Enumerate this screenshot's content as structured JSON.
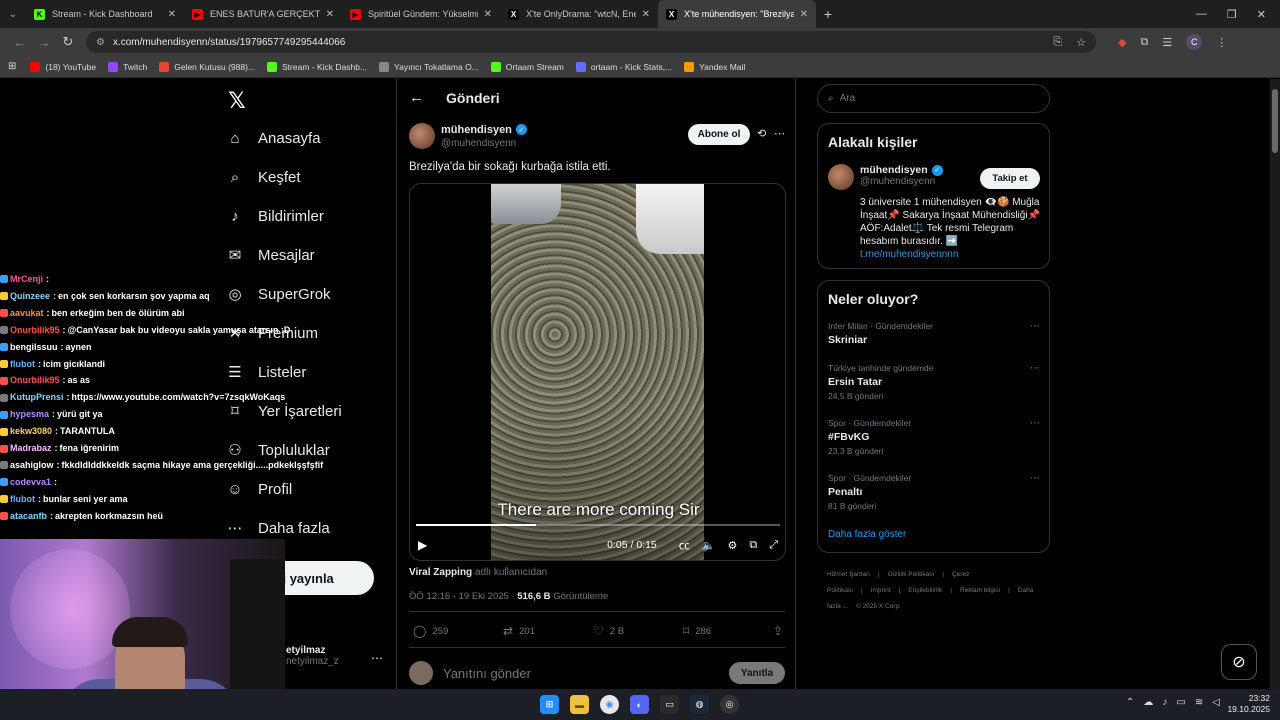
{
  "browser": {
    "tabs": [
      {
        "title": "Stream - Kick Dashboard",
        "icon": "kick-icon",
        "active": false
      },
      {
        "title": "ENES BATUR'A GERÇEKTEN NE",
        "icon": "youtube-icon",
        "active": false
      },
      {
        "title": "Spiritüel Gündem: Yükselmiş Ü",
        "icon": "youtube-icon",
        "active": false
      },
      {
        "title": "X'te OnlyDrama: \"wtcN, Enes B",
        "icon": "x-icon",
        "active": false
      },
      {
        "title": "X'te mühendisyen: \"Brezilya'da",
        "icon": "x-icon",
        "active": true
      }
    ],
    "url": "x.com/muhendisyenn/status/1979657749295444066",
    "avatar_letter": "C",
    "bookmarks": [
      {
        "label": "(18) YouTube",
        "icon": "youtube-icon",
        "color": "#ff0000"
      },
      {
        "label": "Twitch",
        "icon": "twitch-icon",
        "color": "#9146ff"
      },
      {
        "label": "Gelen Kutusu (988)...",
        "icon": "gmail-icon",
        "color": "#ea4335"
      },
      {
        "label": "Stream - Kick Dashb...",
        "icon": "kick-icon",
        "color": "#53fc18"
      },
      {
        "label": "Yayıncı Tokatlama O...",
        "icon": "globe-icon",
        "color": "#888888"
      },
      {
        "label": "Ortaam Stream",
        "icon": "kick-icon",
        "color": "#53fc18"
      },
      {
        "label": "ortaam - Kick Stats,...",
        "icon": "chart-icon",
        "color": "#6a6aff"
      },
      {
        "label": "Yandex Mail",
        "icon": "mail-icon",
        "color": "#ff9900"
      }
    ]
  },
  "nav": {
    "items": [
      {
        "label": "Anasayfa",
        "icon": "home-icon",
        "glyph": "⌂"
      },
      {
        "label": "Keşfet",
        "icon": "search-icon",
        "glyph": "⌕"
      },
      {
        "label": "Bildirimler",
        "icon": "bell-icon",
        "glyph": "♪"
      },
      {
        "label": "Mesajlar",
        "icon": "mail-icon",
        "glyph": "✉"
      },
      {
        "label": "SuperGrok",
        "icon": "grok-icon",
        "glyph": "◎"
      },
      {
        "label": "Premium",
        "icon": "x-icon",
        "glyph": "✕"
      },
      {
        "label": "Listeler",
        "icon": "list-icon",
        "glyph": "☰"
      },
      {
        "label": "Yer İşaretleri",
        "icon": "bookmark-icon",
        "glyph": "⌑"
      },
      {
        "label": "Topluluklar",
        "icon": "people-icon",
        "glyph": "⚇"
      },
      {
        "label": "Profil",
        "icon": "person-icon",
        "glyph": "☺"
      },
      {
        "label": "Daha fazla",
        "icon": "more-circle-icon",
        "glyph": "⋯"
      }
    ],
    "post_button": "eri yayınla",
    "account_name": "etyilmaz",
    "account_handle": "netyilmaz_z"
  },
  "chat": [
    {
      "user": "MrCenji",
      "msg": "",
      "color": "#ff4fa0"
    },
    {
      "user": "Quinzeee",
      "msg": "en çok sen korkarsın şov yapma aq",
      "color": "#7fd6ff"
    },
    {
      "user": "aavukat",
      "msg": "ben erkeğim ben de ölürüm abi",
      "color": "#ff8c42"
    },
    {
      "user": "Onurbilik95",
      "msg": "@CanYasar bak bu videoyu sakla yamuşa atarsın :D",
      "color": "#ff4f4f"
    },
    {
      "user": "bengilssuu",
      "msg": "aynen",
      "color": "#ffffff"
    },
    {
      "user": "flubot",
      "msg": "icim gicıklandi",
      "color": "#6ab0ff"
    },
    {
      "user": "Onurbilik95",
      "msg": "as as",
      "color": "#ff4f4f"
    },
    {
      "user": "KutupPrensi",
      "msg": "https://www.youtube.com/watch?v=7zsqkWoKaqs",
      "color": "#7fd6ff"
    },
    {
      "user": "hypesma",
      "msg": "yürü git ya",
      "color": "#b48cff"
    },
    {
      "user": "kekw3080",
      "msg": "TARANTULA",
      "color": "#ffd24f"
    },
    {
      "user": "Madrabaz",
      "msg": "fena iğrenirim",
      "color": "#ffb6ff"
    },
    {
      "user": "asahiglow",
      "msg": "fkkdldlddkkeldk saçma hikaye ama gerçekliği.....pdkeklşşfşfif",
      "color": "#ffffff"
    },
    {
      "user": "codevva1",
      "msg": "",
      "color": "#b48cff"
    },
    {
      "user": "flubot",
      "msg": "bunlar seni yer ama",
      "color": "#6ab0ff"
    },
    {
      "user": "atacanfb",
      "msg": "akrepten korkmazsın heü",
      "color": "#7fd6ff"
    }
  ],
  "main": {
    "header_title": "Gönderi",
    "author_name": "mühendisyen",
    "author_handle": "@muhendisyenn",
    "follow_label": "Abone ol",
    "tweet_text": "Brezilya'da bir sokağı kurbağa istila etti.",
    "video": {
      "subtitle": "There are more coming Sir",
      "time": "0:05 / 0:15",
      "progress": 0.33
    },
    "credit_name": "Viral Zapping",
    "credit_suffix": "adlı kullanıcıdan",
    "timestamp": "ÖÖ 12:16 · 19 Eki 2025 · ",
    "views_count": "516,6 B",
    "views_label": "Görüntüleme",
    "stats": {
      "replies": "259",
      "reposts": "201",
      "likes": "2 B",
      "bookmarks": "286"
    },
    "reply_placeholder": "Yanıtını gönder",
    "reply_button": "Yanıtla"
  },
  "sidebar": {
    "search_placeholder": "Ara",
    "related_title": "Alakalı kişiler",
    "related_name": "mühendisyen",
    "related_handle": "@muhendisyenn",
    "related_follow": "Takip et",
    "bio": "3 üniversite 1 mühendisyen 👁‍🗨🍪 Muğla İnşaat📌 Sakarya İnşaat Mühendisliği📌 AÖF:Adalet⚖️ Tek resmi Telegram hesabım burasıdır. ➡️",
    "bio_link": "t.me/muhendisyennnn",
    "trends_title": "Neler oluyor?",
    "trends": [
      {
        "context": "Inter Milan · Gündemdekiler",
        "name": "Skriniar",
        "posts": ""
      },
      {
        "context": "Türkiye tarihinde gündemde",
        "name": "Ersin Tatar",
        "posts": "24,5 B gönderi"
      },
      {
        "context": "Spor · Gündemdekiler",
        "name": "#FBvKG",
        "posts": "23,3 B gönderi"
      },
      {
        "context": "Spor · Gündemdekiler",
        "name": "Penaltı",
        "posts": "81 B gönderi"
      }
    ],
    "show_more": "Daha fazla göster",
    "footer": [
      "Hizmet Şartları",
      "|",
      "Gizlilik Politikası",
      "|",
      "Çerez Politikası",
      "|",
      "Imprint",
      "|",
      "Erişilebilirlik",
      "|",
      "Reklam bilgisi",
      "|",
      "Daha fazla ...",
      "© 2025 X Corp."
    ]
  },
  "taskbar": {
    "time": "23:32",
    "date": "19.10.2025"
  }
}
